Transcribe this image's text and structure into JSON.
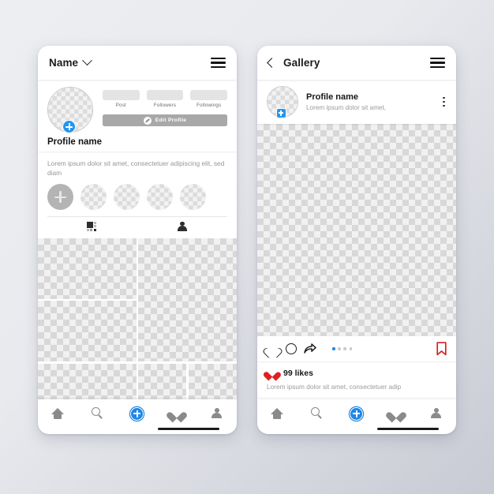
{
  "background": {
    "color_start": "#eceef1",
    "color_end": "#c8cbd4"
  },
  "accent": {
    "blue": "#1e88e5",
    "red": "#e02020",
    "grey": "#8a8a8a"
  },
  "profile_screen": {
    "topbar": {
      "title": "Name",
      "chevron_icon": "chevron-down-icon",
      "menu_icon": "hamburger-menu-icon"
    },
    "avatar": {
      "badge_icon": "add-story-plus-icon"
    },
    "stats": [
      {
        "label": "Post",
        "value": ""
      },
      {
        "label": "Followers",
        "value": ""
      },
      {
        "label": "Followings",
        "value": ""
      }
    ],
    "edit_button": {
      "label": "Edit Profile",
      "icon": "pencil-icon"
    },
    "profile_name": "Profile name",
    "bio": "Lorem ipsum dolor sit amet, consectetuer adipiscing elit, sed diam",
    "stories": {
      "add_label": "add-story",
      "count": 4
    },
    "tabs": [
      {
        "name": "grid-tab",
        "icon": "grid-icon"
      },
      {
        "name": "tagged-tab",
        "icon": "person-icon"
      }
    ],
    "grid_tiles": 6
  },
  "gallery_screen": {
    "topbar": {
      "back_icon": "chevron-left-icon",
      "title": "Gallery",
      "menu_icon": "hamburger-menu-icon"
    },
    "post_header": {
      "name": "Profile name",
      "subtitle": "Lorem ipsum dolor sit amet,",
      "badge_icon": "add-plus-icon",
      "more_icon": "more-vertical-icon"
    },
    "actions": {
      "like_icon": "heart-outline-icon",
      "comment_icon": "comment-bubble-icon",
      "share_icon": "share-arrow-icon",
      "bookmark_icon": "bookmark-icon",
      "pagination": {
        "total": 4,
        "active_index": 0
      }
    },
    "likes": {
      "heart_icon": "heart-filled-icon",
      "text": "99 likes"
    },
    "caption": "Lorem ipsum dolor sit amet, consectetuer adip"
  },
  "bottom_nav": [
    {
      "name": "home",
      "icon": "home-icon"
    },
    {
      "name": "search",
      "icon": "search-icon"
    },
    {
      "name": "create",
      "icon": "plus-circle-icon"
    },
    {
      "name": "activity",
      "icon": "heart-filled-icon"
    },
    {
      "name": "profile",
      "icon": "person-icon"
    }
  ]
}
